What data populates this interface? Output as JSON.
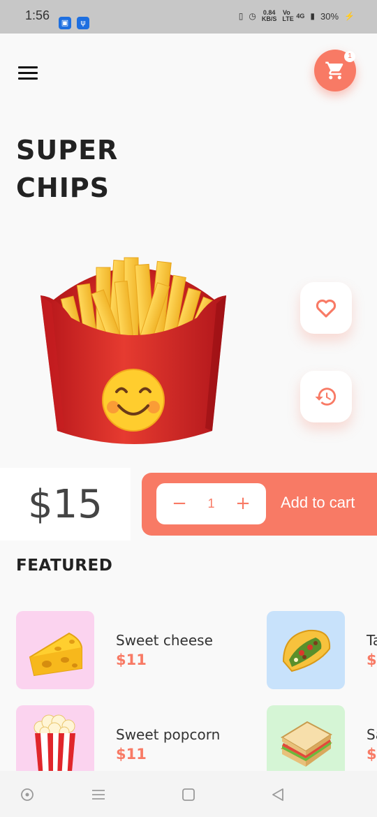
{
  "status_bar": {
    "time": "1:56",
    "speed": "0.84",
    "speed_unit": "KB/S",
    "volte": "Vo LTE",
    "network": "4G",
    "battery": "30%"
  },
  "header": {
    "cart_count": "1"
  },
  "product": {
    "title_line1": "SUPER",
    "title_line2": "CHIPS",
    "image_icon": "fries-illustration",
    "price": "$15"
  },
  "cart_controls": {
    "minus": "−",
    "quantity": "1",
    "plus": "+",
    "add_label": "Add to cart"
  },
  "featured": {
    "title": "FEATURED",
    "items": [
      {
        "name": "Sweet cheese",
        "price": "$11",
        "bg": "#fbd3ef",
        "icon": "cheese-icon"
      },
      {
        "name": "Ta",
        "price": "$",
        "bg": "#c8e2fb",
        "icon": "taco-icon"
      },
      {
        "name": "Sweet popcorn",
        "price": "$11",
        "bg": "#fbd3ef",
        "icon": "popcorn-icon"
      },
      {
        "name": "Sa",
        "price": "$",
        "bg": "#d5f5d5",
        "icon": "sandwich-icon"
      }
    ]
  },
  "colors": {
    "accent": "#f87a65",
    "background": "#f9f9f9",
    "status_bar": "#c7c7c7"
  }
}
